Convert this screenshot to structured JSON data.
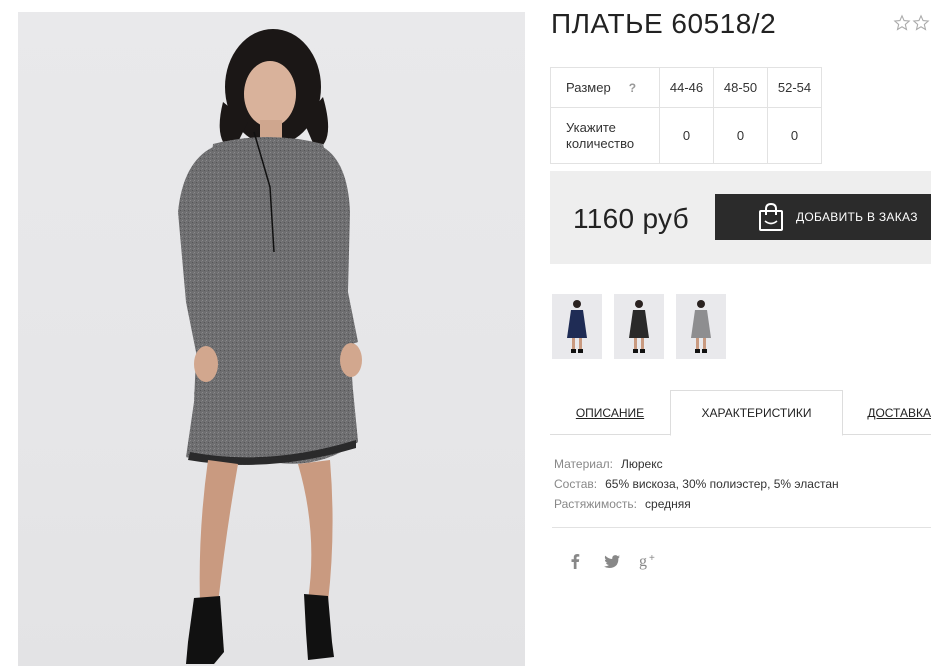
{
  "product": {
    "title": "ПЛАТЬЕ 60518/2",
    "rating_icon": "star-outline-icon"
  },
  "sizes": {
    "label": "Размер",
    "help": "?",
    "options": [
      "44-46",
      "48-50",
      "52-54"
    ],
    "qty_label": "Укажите количество",
    "quantities": [
      "0",
      "0",
      "0"
    ]
  },
  "price": {
    "value": "1160 руб",
    "button_label": "ДОБАВИТЬ В ЗАКАЗ",
    "button_icon": "shopping-bag-icon"
  },
  "thumbnails": [
    {
      "color": "#1f2c55"
    },
    {
      "color": "#2a2a2a"
    },
    {
      "color": "#8e8e90"
    }
  ],
  "tabs": {
    "description": "ОПИСАНИЕ",
    "characteristics": "ХАРАКТЕРИСТИКИ",
    "delivery": "ДОСТАВКА"
  },
  "characteristics": [
    {
      "key": "Материал:",
      "value": "Люрекс"
    },
    {
      "key": "Состав:",
      "value": "65% вискоза, 30% полиэстер, 5% эластан"
    },
    {
      "key": "Растяжимость:",
      "value": "средняя"
    }
  ],
  "social": {
    "facebook": "facebook-icon",
    "twitter": "twitter-icon",
    "googleplus": "google-plus-icon"
  },
  "colors": {
    "button_bg": "#2b2b2b",
    "price_box_bg": "#eeeeee",
    "dress_main": "#6d6d6f"
  }
}
